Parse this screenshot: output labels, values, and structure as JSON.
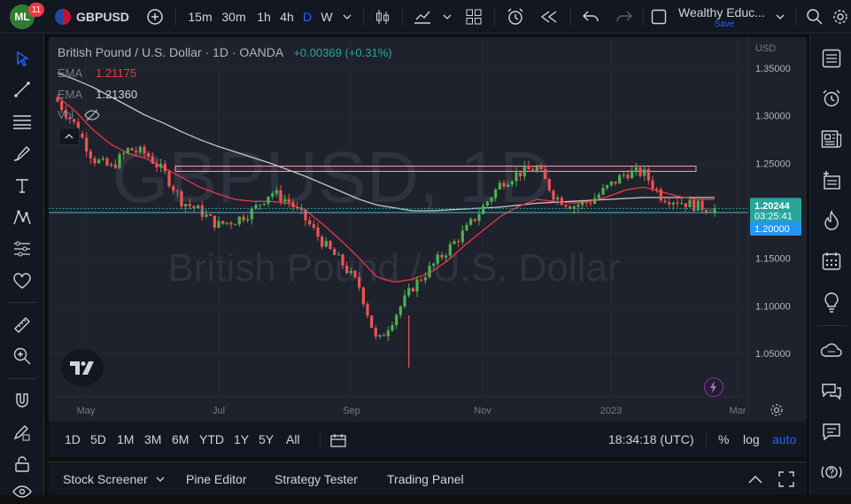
{
  "topbar": {
    "notifications_count": "11",
    "symbol": "GBPUSD",
    "intervals": [
      "15m",
      "30m",
      "1h",
      "4h",
      "D",
      "W"
    ],
    "active_interval": "D",
    "layout_name": "Wealthy Educ...",
    "save_label": "Save"
  },
  "legend": {
    "title": "British Pound / U.S. Dollar · 1D · OANDA",
    "change": "+0.00369 (+0.31%)",
    "ema1_label": "EMA",
    "ema1_value": "1.21175",
    "ema2_label": "EMA",
    "ema2_value": "1.21360",
    "vol_label": "Vol"
  },
  "watermark": {
    "symbol": "GBPUSD, 1D",
    "description": "British Pound / U.S. Dollar"
  },
  "price_axis": {
    "currency": "USD",
    "ticks": [
      "1.35000",
      "1.30000",
      "1.25000",
      "1.15000",
      "1.10000",
      "1.05000"
    ],
    "current_price": "1.20244",
    "countdown": "03:25:41",
    "level_label": "1.20000"
  },
  "time_axis": {
    "ticks": [
      "May",
      "Jul",
      "Sep",
      "Nov",
      "2023",
      "Mar"
    ]
  },
  "bottombar": {
    "ranges": [
      "1D",
      "5D",
      "1M",
      "3M",
      "6M",
      "YTD",
      "1Y",
      "5Y",
      "All"
    ],
    "clock": "18:34:18 (UTC)",
    "percent_label": "%",
    "log_label": "log",
    "auto_label": "auto"
  },
  "panels": {
    "tabs": [
      "Stock Screener",
      "Pine Editor",
      "Strategy Tester",
      "Trading Panel"
    ]
  },
  "colors": {
    "up": "#26a69a",
    "up_bright": "#4caf50",
    "down": "#ef5350",
    "down_dark": "#f23645",
    "ema_fast": "#f23645",
    "ema_slow": "#c7c7c7",
    "horizontal_line": "#22ab94",
    "rectangle": "#f7a4b2",
    "accent": "#2962ff"
  },
  "chart_data": {
    "type": "candlestick",
    "x_ticks": [
      "May",
      "Jul",
      "Sep",
      "Nov",
      "2023",
      "Mar"
    ],
    "y_ticks": [
      1.35,
      1.3,
      1.25,
      1.15,
      1.1,
      1.05
    ],
    "ylim": [
      1.0,
      1.37
    ],
    "current_price": 1.20244,
    "horizontal_level": 1.2,
    "resistance_zone": [
      1.2415,
      1.247
    ],
    "series_anchors": {
      "close": [
        1.315,
        1.29,
        1.255,
        1.245,
        1.265,
        1.26,
        1.24,
        1.21,
        1.2,
        1.185,
        1.19,
        1.2,
        1.22,
        1.21,
        1.19,
        1.165,
        1.145,
        1.12,
        1.06,
        1.09,
        1.12,
        1.14,
        1.16,
        1.18,
        1.205,
        1.23,
        1.24,
        1.245,
        1.215,
        1.205,
        1.21,
        1.225,
        1.24,
        1.24,
        1.215,
        1.21,
        1.205,
        1.202
      ],
      "ema_fast": [
        1.32,
        1.305,
        1.285,
        1.27,
        1.26,
        1.255,
        1.245,
        1.235,
        1.225,
        1.218,
        1.212,
        1.21,
        1.21,
        1.208,
        1.2,
        1.185,
        1.168,
        1.15,
        1.13,
        1.125,
        1.128,
        1.135,
        1.148,
        1.165,
        1.18,
        1.195,
        1.205,
        1.212,
        1.21,
        1.208,
        1.21,
        1.215,
        1.222,
        1.225,
        1.22,
        1.215,
        1.212,
        1.212
      ],
      "ema_slow": [
        1.345,
        1.338,
        1.33,
        1.32,
        1.31,
        1.3,
        1.292,
        1.283,
        1.275,
        1.268,
        1.262,
        1.256,
        1.25,
        1.243,
        1.236,
        1.228,
        1.22,
        1.212,
        1.206,
        1.203,
        1.2,
        1.2,
        1.201,
        1.202,
        1.203,
        1.204,
        1.206,
        1.208,
        1.209,
        1.21,
        1.211,
        1.212,
        1.213,
        1.214,
        1.214,
        1.214,
        1.214,
        1.214
      ]
    }
  }
}
